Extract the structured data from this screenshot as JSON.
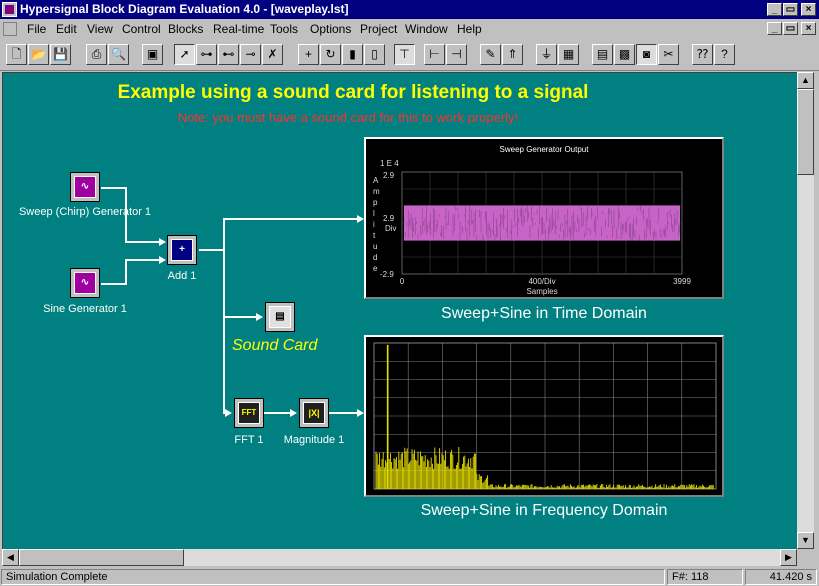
{
  "window": {
    "title": "Hypersignal Block Diagram Evaluation 4.0 - [waveplay.lst]",
    "controls": {
      "minimize": "_",
      "maximize": "▭",
      "close": "×"
    }
  },
  "menu": [
    "File",
    "Edit",
    "View",
    "Control",
    "Blocks",
    "Real-time",
    "Tools",
    "Options",
    "Project",
    "Window",
    "Help"
  ],
  "toolbar": {
    "buttons": [
      "new",
      "open",
      "save",
      "print",
      "print-preview",
      "window",
      "pointer",
      "connect-1",
      "connect-2",
      "connect-3",
      "delete-connection",
      "add-junction",
      "rotate",
      "block-a",
      "block-b",
      "align-left",
      "align-right",
      "pencil",
      "up",
      "channel-a",
      "channel-b",
      "view-a",
      "grid",
      "view-b",
      "view-c",
      "context-help",
      "help"
    ]
  },
  "canvas": {
    "title": "Example using a sound card for listening to a signal",
    "note": "Note: you must have a sound card for this to work properly!",
    "blocks": {
      "sweep": {
        "label": "Sweep (Chirp) Generator 1"
      },
      "sine": {
        "label": "Sine Generator 1"
      },
      "add": {
        "label": "Add 1",
        "glyph": "+"
      },
      "soundcard": {
        "label": "Sound Card"
      },
      "fft": {
        "label": "FFT 1",
        "glyph": "FFT"
      },
      "magnitude": {
        "label": "Magnitude 1",
        "glyph": "|X|"
      }
    },
    "time_plot": {
      "title": "Sweep Generator Output",
      "exponent": "1 E 4",
      "ylabel": [
        "A",
        "m",
        "p",
        "l",
        "i",
        "t",
        "u",
        "d",
        "e"
      ],
      "yticks": [
        "2.9",
        "2.9",
        "-2.9"
      ],
      "ydiv": "Div",
      "xticks": [
        "0",
        "400/Div",
        "3999"
      ],
      "xlabel": "Samples",
      "caption": "Sweep+Sine in Time Domain"
    },
    "freq_plot": {
      "caption": "Sweep+Sine in Frequency Domain"
    }
  },
  "chart_data": [
    {
      "type": "line",
      "title": "Sweep Generator Output",
      "xlabel": "Samples",
      "ylabel": "Amplitude",
      "xlim": [
        0,
        3999
      ],
      "ylim": [
        -2.9,
        2.9
      ],
      "y_exponent": "1 E 4",
      "grid": true,
      "series": [
        {
          "color": "#c864c8",
          "envelope": [
            -1.0,
            1.0
          ]
        }
      ]
    },
    {
      "type": "line",
      "title": "",
      "grid": true,
      "series": [
        {
          "color": "#e8e000",
          "peak_at": 0.04,
          "band": [
            0.0,
            0.3
          ]
        }
      ]
    }
  ],
  "status": {
    "text": "Simulation Complete",
    "frame": "F#: 118",
    "time": "41.420 s"
  },
  "colors": {
    "workspace": "#008080",
    "title": "#ffff00",
    "note": "#ff3030",
    "trace_time": "#c864c8",
    "trace_freq": "#e8e000"
  }
}
